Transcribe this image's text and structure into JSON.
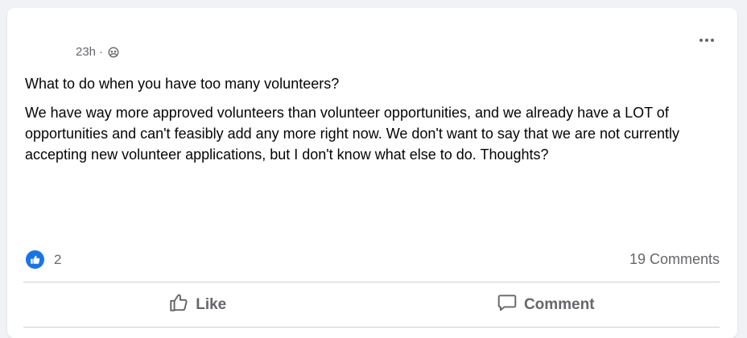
{
  "post": {
    "time": "23h",
    "separator": "·",
    "privacy_icon": "group-icon",
    "title": "What to do when you have too many volunteers?",
    "body": "We have way more approved volunteers than volunteer opportunities, and we already have a LOT of opportunities and can't feasibly add any more right now. We don't want to say that we are not currently accepting new volunteer applications, but I don't know what else to do. Thoughts?"
  },
  "stats": {
    "reaction_icon": "like-icon",
    "reaction_count": "2",
    "comments": "19 Comments"
  },
  "actions": {
    "like_label": "Like",
    "comment_label": "Comment"
  },
  "colors": {
    "accent": "#1b74e4",
    "secondary_text": "#65676b",
    "primary_text": "#050505",
    "background": "#f0f2f5"
  }
}
